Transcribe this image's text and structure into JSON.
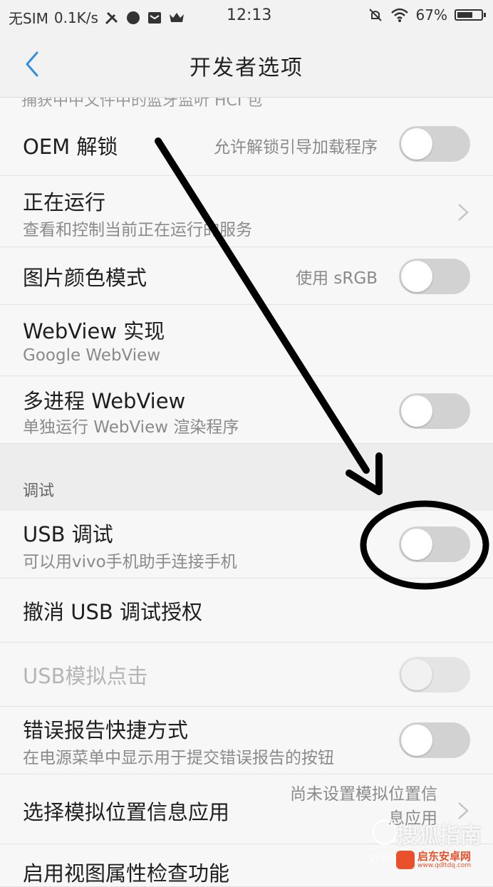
{
  "status_bar": {
    "carrier": "无SIM",
    "speed": "0.1K/s",
    "time": "12:13",
    "battery_text": "67%",
    "battery_level": 0.67,
    "left_icons": [
      "tools-icon",
      "app-icon",
      "mail-icon",
      "crown-icon"
    ],
    "right_icons": [
      "mute-icon",
      "wifi-icon",
      "battery-icon"
    ]
  },
  "header": {
    "title": "开发者选项",
    "back_icon": "chevron-left-icon"
  },
  "partial_row_text": "捕获中中文件中的蓝牙监听 HCI 包",
  "rows": [
    {
      "title": "OEM 解锁",
      "value": "允许解锁引导加载程序",
      "control": "switch",
      "on": false
    },
    {
      "title": "正在运行",
      "subtitle": "查看和控制当前正在运行的服务",
      "control": "chevron"
    },
    {
      "title": "图片颜色模式",
      "value": "使用 sRGB",
      "control": "switch",
      "on": false
    },
    {
      "title": "WebView 实现",
      "subtitle": "Google WebView"
    },
    {
      "title": "多进程 WebView",
      "subtitle": "单独运行 WebView 渲染程序",
      "control": "switch",
      "on": false
    }
  ],
  "section": {
    "label": "调试"
  },
  "debug_rows": [
    {
      "title": "USB 调试",
      "subtitle": "可以用vivo手机助手连接手机",
      "control": "switch",
      "on": false
    },
    {
      "title": "撤消 USB 调试授权"
    },
    {
      "title": "USB模拟点击",
      "control": "switch",
      "on": false,
      "disabled": true
    },
    {
      "title": "错误报告快捷方式",
      "subtitle": "在电源菜单中显示用于提交错误报告的按钮",
      "control": "switch",
      "on": false
    },
    {
      "title": "选择模拟位置信息应用",
      "value_line1": "尚未设置模拟位置信",
      "value_line2": "息应用",
      "control": "chevron"
    },
    {
      "title": "启用视图属性检查功能"
    }
  ],
  "watermark": {
    "text": "搜狐指南",
    "url": "zhinan.sohu.com"
  },
  "badge": {
    "text": "启东安卓网",
    "url": "www.qdltdq.com"
  }
}
